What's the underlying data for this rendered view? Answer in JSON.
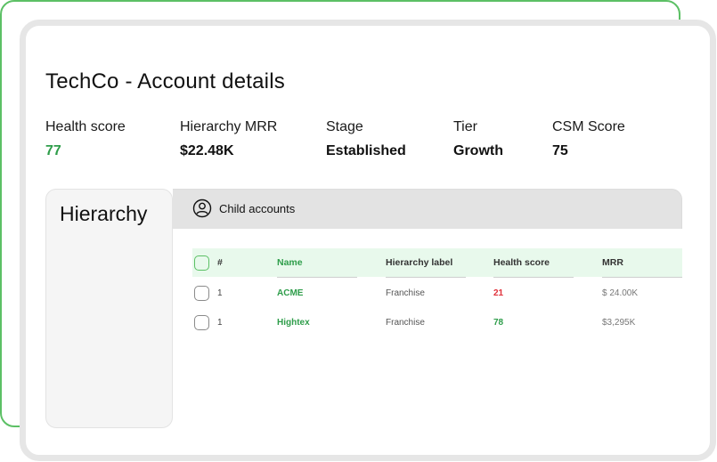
{
  "page": {
    "title": "TechCo - Account details"
  },
  "metrics": [
    {
      "label": "Health score",
      "value": "77"
    },
    {
      "label": "Hierarchy MRR",
      "value": "$22.48K"
    },
    {
      "label": "Stage",
      "value": "Established"
    },
    {
      "label": "Tier",
      "value": "Growth"
    },
    {
      "label": "CSM Score",
      "value": "75"
    }
  ],
  "sidebar": {
    "title": "Hierarchy"
  },
  "tabs": [
    {
      "label": "Child accounts",
      "icon": "user-circle-icon"
    }
  ],
  "table": {
    "columns": [
      "#",
      "Name",
      "Hierarchy label",
      "Health score",
      "MRR"
    ],
    "rows": [
      {
        "index": "1",
        "name": "ACME",
        "label": "Franchise",
        "health": "21",
        "mrr": "$ 24.00K"
      },
      {
        "index": "1",
        "name": "Hightex",
        "label": "Franchise",
        "health": "78",
        "mrr": "$3,295K"
      }
    ]
  },
  "colors": {
    "accent_green": "#2e9d4a",
    "border_green": "#5cc065",
    "danger_red": "#e0303a",
    "header_bg": "#e8f9ec"
  }
}
